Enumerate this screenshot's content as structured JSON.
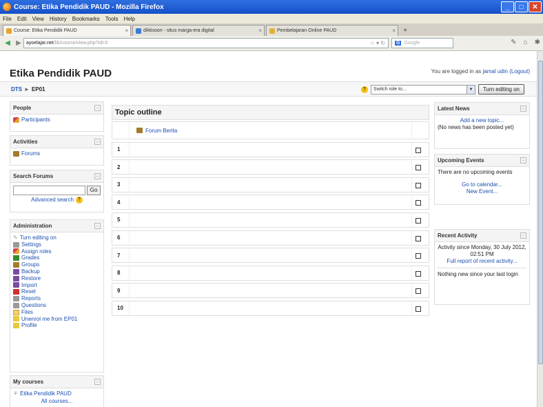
{
  "window": {
    "title": "Course: Etika Pendidik PAUD - Mozilla Firefox",
    "controls": [
      "_",
      "□",
      "✕"
    ]
  },
  "menu": [
    "File",
    "Edit",
    "View",
    "History",
    "Bookmarks",
    "Tools",
    "Help"
  ],
  "tabs": [
    {
      "label": "Course: Etika Pendidik PAUD",
      "active": true
    },
    {
      "label": "diktisoon - situs marga-era digital",
      "active": false
    },
    {
      "label": "Pembelajaran Online PAUD",
      "active": false
    }
  ],
  "address": {
    "domain": "ayoelajar.net",
    "path": "/lib/course/view.php?id=3",
    "search_placeholder": "Google"
  },
  "page": {
    "course_title": "Etika Pendidik PAUD",
    "login_prefix": "You are logged in as",
    "login_user": "jamal udin",
    "logout": "(Logout)",
    "breadcrumb": {
      "root": "DTS",
      "sep": "►",
      "current": "EP01"
    },
    "switch_role_placeholder": "Switch role to...",
    "turn_editing_label": "Turn editing on"
  },
  "left": {
    "people": {
      "header": "People",
      "items": [
        {
          "label": "Participants",
          "icon": "people-icon"
        }
      ]
    },
    "activities": {
      "header": "Activities",
      "items": [
        {
          "label": "Forums",
          "icon": "forum-icon"
        }
      ]
    },
    "search": {
      "header": "Search Forums",
      "go_label": "Go",
      "advanced_label": "Advanced search"
    },
    "admin": {
      "header": "Administration",
      "items": [
        {
          "label": "Turn editing on",
          "icon": "edit-icon"
        },
        {
          "label": "Settings",
          "icon": "settings-icon"
        },
        {
          "label": "Assign roles",
          "icon": "roles-icon"
        },
        {
          "label": "Grades",
          "icon": "grades-icon"
        },
        {
          "label": "Groups",
          "icon": "groups-icon"
        },
        {
          "label": "Backup",
          "icon": "backup-icon"
        },
        {
          "label": "Restore",
          "icon": "restore-icon"
        },
        {
          "label": "Import",
          "icon": "import-icon"
        },
        {
          "label": "Reset",
          "icon": "reset-icon"
        },
        {
          "label": "Reports",
          "icon": "reports-icon"
        },
        {
          "label": "Questions",
          "icon": "questions-icon"
        },
        {
          "label": "Files",
          "icon": "files-icon"
        },
        {
          "label": "Unenrol me from EP01",
          "icon": "unenrol-icon"
        },
        {
          "label": "Profile",
          "icon": "profile-icon"
        }
      ]
    },
    "courses": {
      "header": "My courses",
      "items": [
        {
          "label": "Etika Pendidik PAUD"
        }
      ],
      "all_courses": "All courses..."
    }
  },
  "topics": {
    "header": "Topic outline",
    "first_item": "Forum Berita",
    "rows": [
      "1",
      "2",
      "3",
      "4",
      "5",
      "6",
      "7",
      "8",
      "9",
      "10"
    ]
  },
  "right": {
    "news": {
      "header": "Latest News",
      "add": "Add a new topic...",
      "empty": "(No news has been posted yet)"
    },
    "events": {
      "header": "Upcoming Events",
      "empty": "There are no upcoming events",
      "calendar": "Go to calendar...",
      "new_event": "New Event..."
    },
    "activity": {
      "header": "Recent Activity",
      "since": "Activity since Monday, 30 July 2012, 02:51 PM",
      "full_report": "Full report of recent activity...",
      "nothing": "Nothing new since your last login"
    }
  }
}
